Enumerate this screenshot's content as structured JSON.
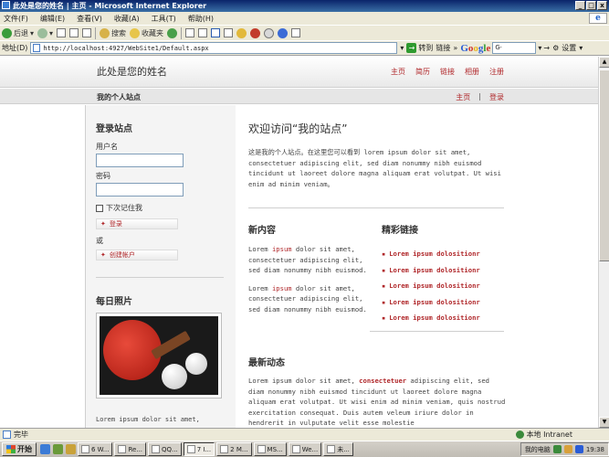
{
  "window": {
    "title": "此处是您的姓名 | 主页 - Microsoft Internet Explorer"
  },
  "menubar": {
    "items": [
      "文件(F)",
      "编辑(E)",
      "查看(V)",
      "收藏(A)",
      "工具(T)",
      "帮助(H)"
    ]
  },
  "toolbar": {
    "back": "后退",
    "search": "搜索",
    "favorites": "收藏夹"
  },
  "addressbar": {
    "label": "地址(D)",
    "url": "http://localhost:4927/WebSite1/Default.aspx",
    "go": "转到",
    "links": "链接",
    "google": "Google",
    "google_field": "G·",
    "settings": "设置"
  },
  "site": {
    "title": "此处是您的姓名",
    "top_nav": [
      "主页",
      "简历",
      "链接",
      "相册",
      "注册"
    ],
    "subtitle": "我的个人站点",
    "sub_nav": {
      "home": "主页",
      "separator": "|",
      "login": "登录"
    }
  },
  "sidebar": {
    "login_title": "登录站点",
    "username_label": "用户名",
    "password_label": "密码",
    "remember_label": "下次记住我",
    "login_button": "登录",
    "or_text": "或",
    "create_account_button": "创建帐户",
    "photo_title": "每日照片",
    "photo_caption": "Lorem ipsum dolor sit amet,"
  },
  "main": {
    "welcome_title": "欢迎访问“我的站点”",
    "intro": "这是我的个人站点。在这里您可以看到 lorem ipsum dolor sit amet, consectetuer adipiscing elit, sed diam nonummy nibh euismod tincidunt ut laoreet dolore magna aliquam erat volutpat. Ut wisi enim ad minim veniam。",
    "news_title": "新内容",
    "news": [
      {
        "lead": "Lorem ",
        "hl": "ipsum",
        "rest": " dolor sit amet, consectetuer adipiscing elit, sed diam nonummy nibh euismod."
      },
      {
        "lead": "Lorem ",
        "hl": "ipsum",
        "rest": " dolor sit amet, consectetuer adipiscing elit, sed diam nonummy nibh euismod."
      }
    ],
    "links_title": "精彩链接",
    "links": [
      "Lorem ipsum dolositionr",
      "Lorem ipsum dolositionr",
      "Lorem ipsum dolositionr",
      "Lorem ipsum dolositionr",
      "Lorem ipsum dolositionr"
    ],
    "latest_title": "最新动态",
    "latest": {
      "lead": "Lorem ipsum dolor sit amet, ",
      "hl": "consectetuer",
      "rest": " adipiscing elit, sed diam nonummy nibh euismod tincidunt ut laoreet dolore magna aliquam erat volutpat. Ut wisi enim ad minim veniam, quis nostrud exercitation consequat. Duis autem veleum iriure dolor in hendrerit in vulputate velit esse molestie"
    }
  },
  "statusbar": {
    "text": "完毕",
    "zone": "本地 Intranet"
  },
  "taskbar": {
    "start": "开始",
    "tasks": [
      "6 W...",
      "Re...",
      "QQ...",
      "7 I...",
      "2 M...",
      "MS...",
      "We...",
      "未..."
    ],
    "tray_label": "我的电脑",
    "clock": "19:38"
  }
}
